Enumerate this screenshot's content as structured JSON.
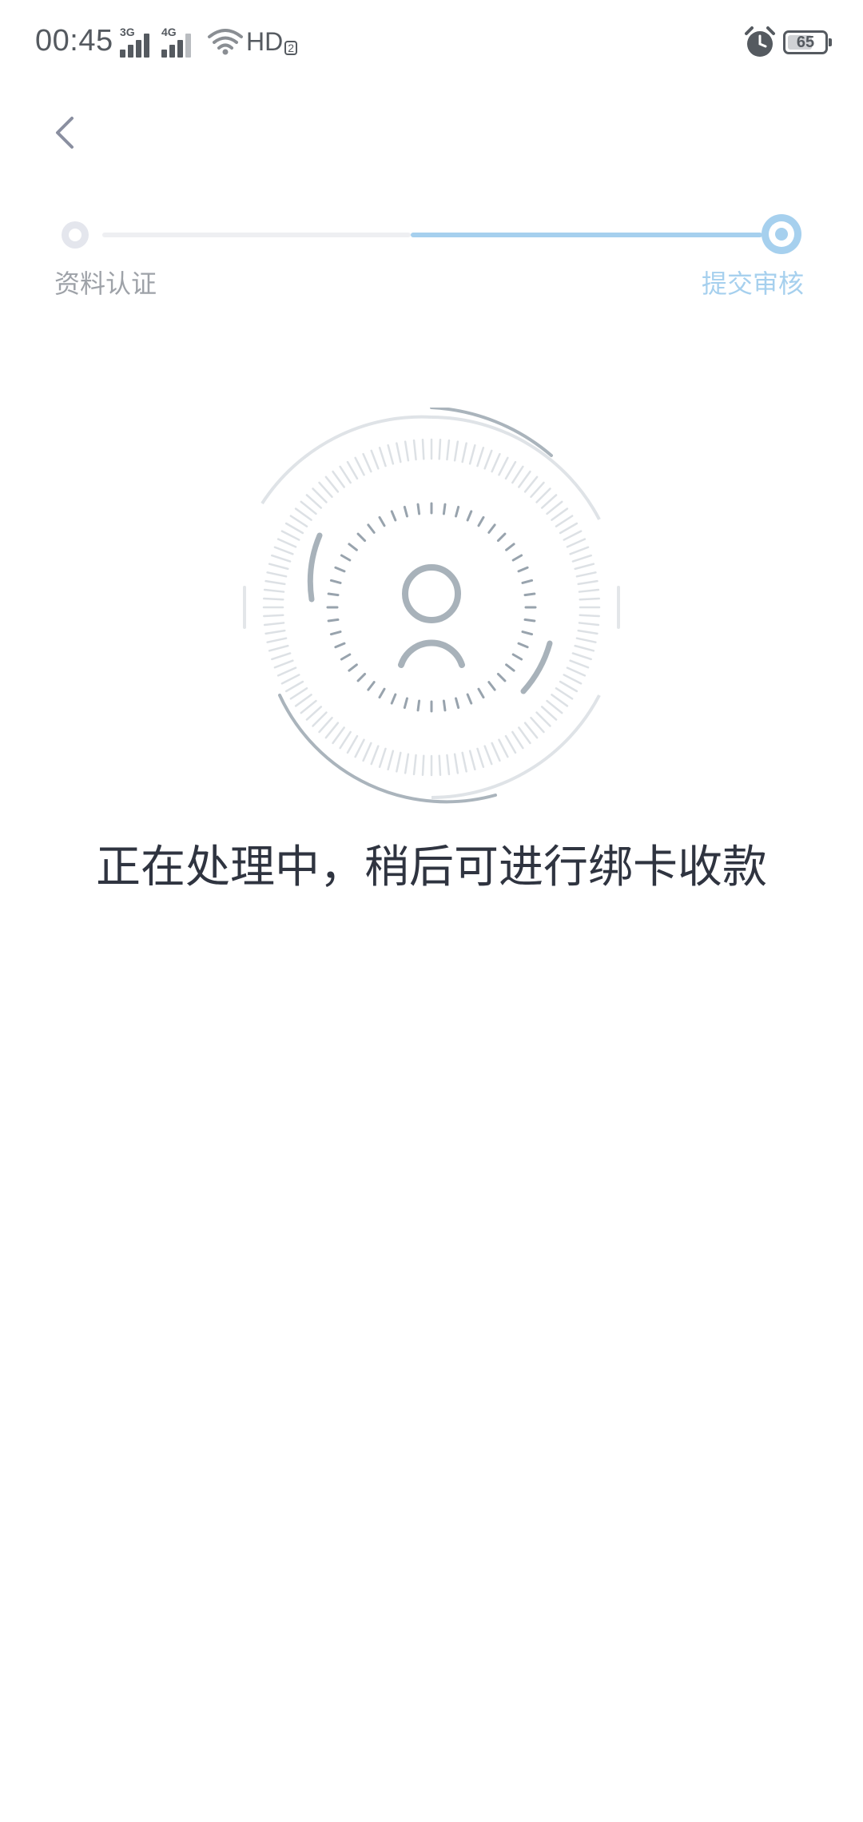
{
  "status_bar": {
    "time": "00:45",
    "signal_1_label": "3G",
    "signal_2_label": "4G",
    "hd_label": "HD",
    "hd_sub": "2",
    "battery_level": "65",
    "icons": [
      "signal-icon",
      "wifi-icon",
      "alarm-icon",
      "battery-icon"
    ]
  },
  "nav": {
    "back_icon": "chevron-left-icon"
  },
  "steps": {
    "items": [
      {
        "label": "资料认证",
        "state": "done"
      },
      {
        "label": "提交审核",
        "state": "current"
      }
    ],
    "colors": {
      "inactive": "#e4e6ed",
      "active": "#a6d0ee",
      "inactive_text": "#9ea2a8"
    }
  },
  "illustration": {
    "icon": "user-scan-icon"
  },
  "message": "正在处理中，稍后可进行绑卡收款"
}
